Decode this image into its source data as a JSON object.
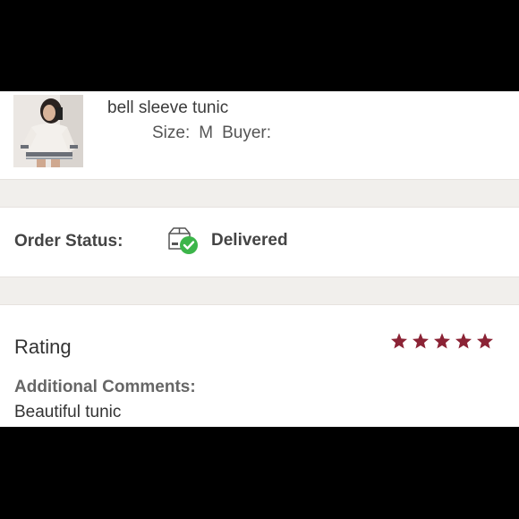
{
  "item": {
    "title": "bell sleeve tunic",
    "size_label": "Size:",
    "size_value": "M",
    "buyer_label": "Buyer:"
  },
  "order": {
    "status_label": "Order Status:",
    "status_value": "Delivered",
    "status_icon": "package-delivered-icon",
    "check_color": "#3cb54a"
  },
  "rating": {
    "label": "Rating",
    "stars": 5,
    "max_stars": 5,
    "star_color": "#8b2335",
    "comments_label": "Additional Comments:",
    "comments_text": "Beautiful tunic"
  }
}
